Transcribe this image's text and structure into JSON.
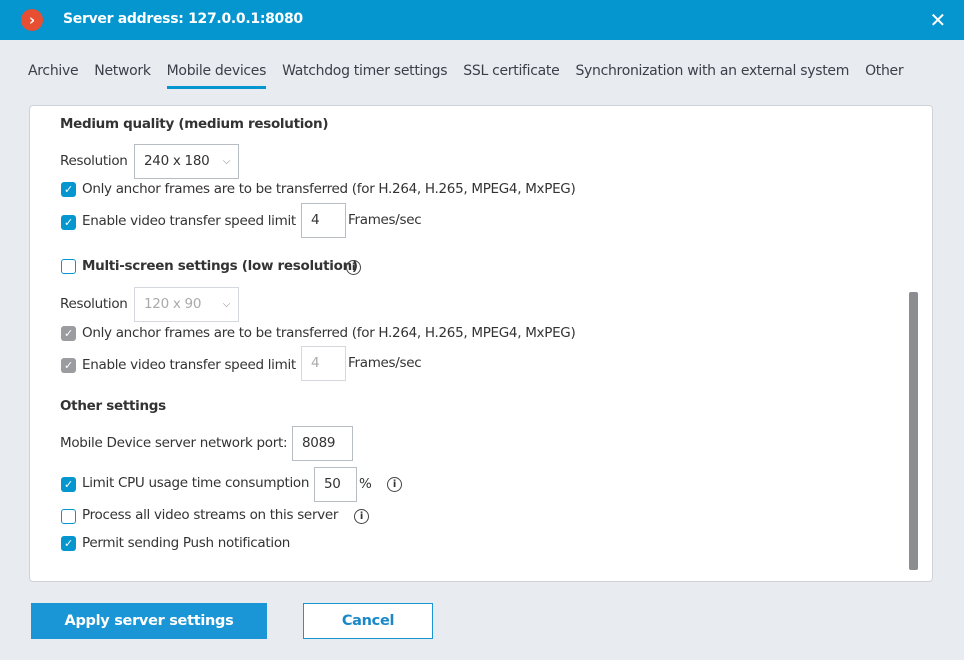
{
  "window": {
    "title": "Server address: 127.0.0.1:8080",
    "close_icon": "close-icon"
  },
  "tabs": [
    {
      "label": "Archive"
    },
    {
      "label": "Network"
    },
    {
      "label": "Mobile devices",
      "active": true
    },
    {
      "label": "Watchdog timer settings"
    },
    {
      "label": "SSL certificate"
    },
    {
      "label": "Synchronization with an external system"
    },
    {
      "label": "Other"
    }
  ],
  "medium": {
    "heading": "Medium quality (medium resolution)",
    "resolution_label": "Resolution",
    "resolution": "240 x 180",
    "anchor_label": "Only anchor frames are to be transferred (for H.264, H.265, MPEG4, MxPEG)",
    "anchor_checked": true,
    "speed_label": "Enable video transfer speed limit",
    "speed_checked": true,
    "speed_value": "4",
    "speed_unit": "Frames/sec"
  },
  "multi": {
    "heading": "Multi-screen settings (low resolution)",
    "checked": false,
    "resolution_label": "Resolution",
    "resolution": "120 x 90",
    "anchor_label": "Only anchor frames are to be transferred (for H.264, H.265, MPEG4, MxPEG)",
    "speed_label": "Enable video transfer speed limit",
    "speed_value": "4",
    "speed_unit": "Frames/sec"
  },
  "other": {
    "heading": "Other settings",
    "port_label": "Mobile Device server network port:",
    "port": "8089",
    "cpu_label": "Limit CPU usage time consumption",
    "cpu_checked": true,
    "cpu_value": "50",
    "cpu_unit": "%",
    "process_label": "Process all video streams on this server",
    "process_checked": false,
    "push_label": "Permit sending Push notification",
    "push_checked": true
  },
  "buttons": {
    "apply": "Apply server settings",
    "cancel": "Cancel"
  },
  "colors": {
    "accent": "#0596d0",
    "logo": "#e84e32"
  }
}
